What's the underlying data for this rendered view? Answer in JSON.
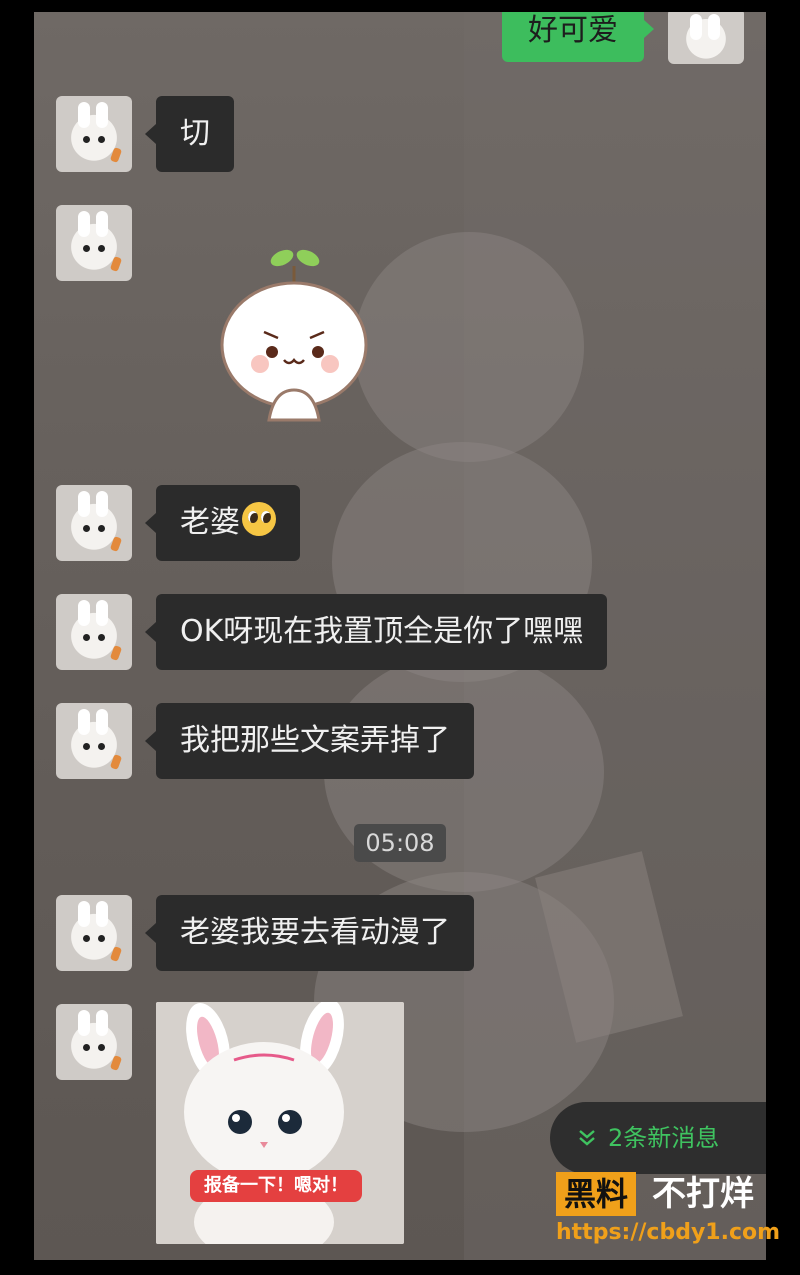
{
  "chat": {
    "my_message": "好可爱",
    "messages": [
      {
        "text": "切"
      },
      {
        "text": "老婆"
      },
      {
        "text": "OK呀现在我置顶全是你了嘿嘿"
      },
      {
        "text": "我把那些文案弄掉了"
      },
      {
        "text": "老婆我要去看动漫了"
      }
    ],
    "timestamp": "05:08",
    "photo_caption": "报备一下！嗯对！",
    "new_messages_label": "2条新消息"
  },
  "watermark": {
    "brand_box": "黑料",
    "brand_text": "不打烊",
    "url": "https://cbdy1.com"
  },
  "colors": {
    "my_bubble": "#3dbd5d",
    "their_bubble": "#2b2b2b",
    "new_msg_text": "#3fc360",
    "watermark_accent": "#f0a01a"
  },
  "icons": {
    "emoji": "pleading-face-icon",
    "new_messages": "double-chevron-down-icon"
  }
}
